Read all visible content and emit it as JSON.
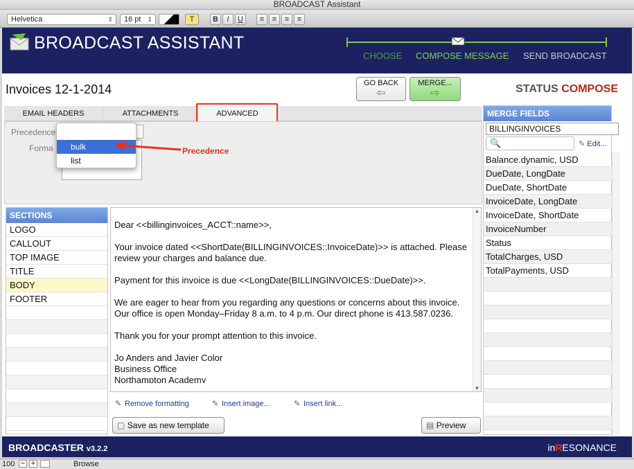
{
  "window": {
    "title": "BROADCAST Assistant"
  },
  "toolbar": {
    "font": "Helvetica",
    "size": "16 pt",
    "style_T": "T",
    "bold": "B",
    "italic": "I",
    "underline": "U"
  },
  "header": {
    "title": "BROADCAST ASSISTANT",
    "steps": [
      "CHOOSE",
      "COMPOSE MESSAGE",
      "SEND BROADCAST"
    ]
  },
  "document": {
    "title": "Invoices 12-1-2014",
    "status_label": "STATUS",
    "status_value": "COMPOSE"
  },
  "nav": {
    "go_back": "GO BACK",
    "merge": "MERGE..."
  },
  "tabs": [
    "EMAIL HEADERS",
    "ATTACHMENTS",
    "ADVANCED"
  ],
  "advanced": {
    "precedence_label": "Precedence",
    "format_label": "Forma",
    "options": [
      "bulk",
      "list"
    ],
    "selected": "bulk",
    "annotation": "Precedence"
  },
  "sections": {
    "title": "SECTIONS",
    "items": [
      "LOGO",
      "CALLOUT",
      "TOP IMAGE",
      "TITLE",
      "BODY",
      "FOOTER"
    ],
    "selected": "BODY"
  },
  "editor": {
    "paragraphs": [
      "Dear <<billinginvoices_ACCT::name>>,",
      "Your invoice dated <<ShortDate(BILLINGINVOICES::InvoiceDate)>> is attached. Please review your charges and balance due.",
      "Payment for this invoice is due <<LongDate(BILLINGINVOICES::DueDate)>>.",
      "We are eager to hear from you regarding any questions or concerns about this invoice. Our office is open Monday–Friday 8 a.m. to 4 p.m. Our direct phone is 413.587.0236.",
      "Thank you for your prompt attention to this invoice."
    ],
    "signature": [
      "Jo Anders and Javier Color",
      "Business Office",
      "Northampton Academy"
    ],
    "tools": [
      "Remove formatting",
      "Insert image...",
      "Insert link..."
    ],
    "save_template": "Save as new template",
    "preview": "Preview"
  },
  "merge": {
    "title": "MERGE FIELDS",
    "table": "BILLINGINVOICES",
    "edit": "Edit...",
    "fields": [
      "Balance.dynamic, USD",
      "DueDate, LongDate",
      "DueDate, ShortDate",
      "InvoiceDate, LongDate",
      "InvoiceDate, ShortDate",
      "InvoiceNumber",
      "Status",
      "TotalCharges, USD",
      "TotalPayments, USD"
    ]
  },
  "footer": {
    "product": "BROADCASTER",
    "version": "v3.2.2",
    "brand_in": "in",
    "brand_r": "R",
    "brand_rest": "ESONANCE"
  },
  "statusbar": {
    "zoom": "100",
    "mode": "Browse"
  },
  "colors": {
    "navy": "#1c2161",
    "green": "#7fc94a",
    "accent_red": "#e8321c",
    "list_blue": "#5a86d3"
  }
}
